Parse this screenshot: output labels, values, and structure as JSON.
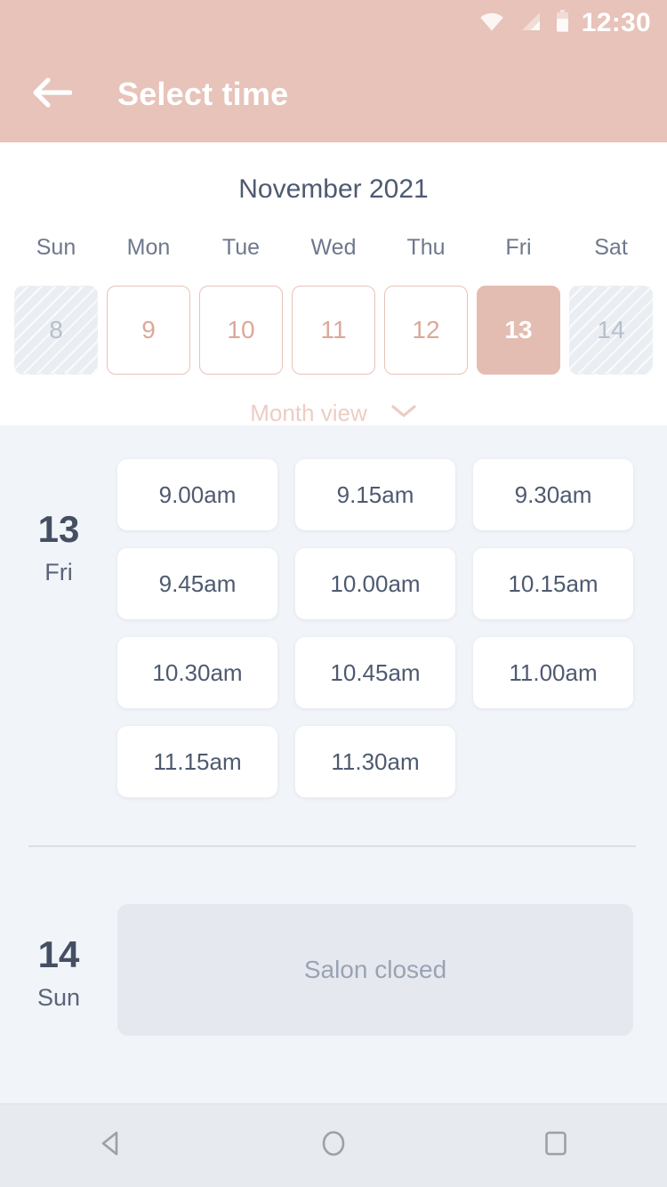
{
  "statusbar": {
    "time": "12:30",
    "icons": [
      "wifi-icon",
      "cellular-signal-icon",
      "battery-icon"
    ]
  },
  "appbar": {
    "title": "Select time",
    "back_icon": "arrow-left-icon"
  },
  "calendar": {
    "month_label": "November 2021",
    "weekdays": [
      "Sun",
      "Mon",
      "Tue",
      "Wed",
      "Thu",
      "Fri",
      "Sat"
    ],
    "days": [
      {
        "num": "8",
        "state": "disabled"
      },
      {
        "num": "9",
        "state": "available"
      },
      {
        "num": "10",
        "state": "available"
      },
      {
        "num": "11",
        "state": "available"
      },
      {
        "num": "12",
        "state": "available"
      },
      {
        "num": "13",
        "state": "selected"
      },
      {
        "num": "14",
        "state": "disabled"
      }
    ],
    "view_toggle": {
      "label": "Month view",
      "icon": "chevron-down-icon"
    }
  },
  "schedule": [
    {
      "day_number": "13",
      "day_of_week": "Fri",
      "slots": [
        "9.00am",
        "9.15am",
        "9.30am",
        "9.45am",
        "10.00am",
        "10.15am",
        "10.30am",
        "10.45am",
        "11.00am",
        "11.15am",
        "11.30am"
      ],
      "closed_label": null
    },
    {
      "day_number": "14",
      "day_of_week": "Sun",
      "slots": [],
      "closed_label": "Salon closed"
    }
  ],
  "navbar": {
    "back": "nav-back-icon",
    "home": "nav-home-icon",
    "recents": "nav-recents-icon"
  },
  "colors": {
    "brand_pink": "#e7c3b9",
    "selected_day": "#e3bdb2",
    "available_day_border": "#e7c3b9",
    "available_day_text": "#dca898",
    "panel_bg": "#f1f4f8",
    "text_dark": "#4e5a70",
    "text_muted": "#9aa3b4"
  }
}
